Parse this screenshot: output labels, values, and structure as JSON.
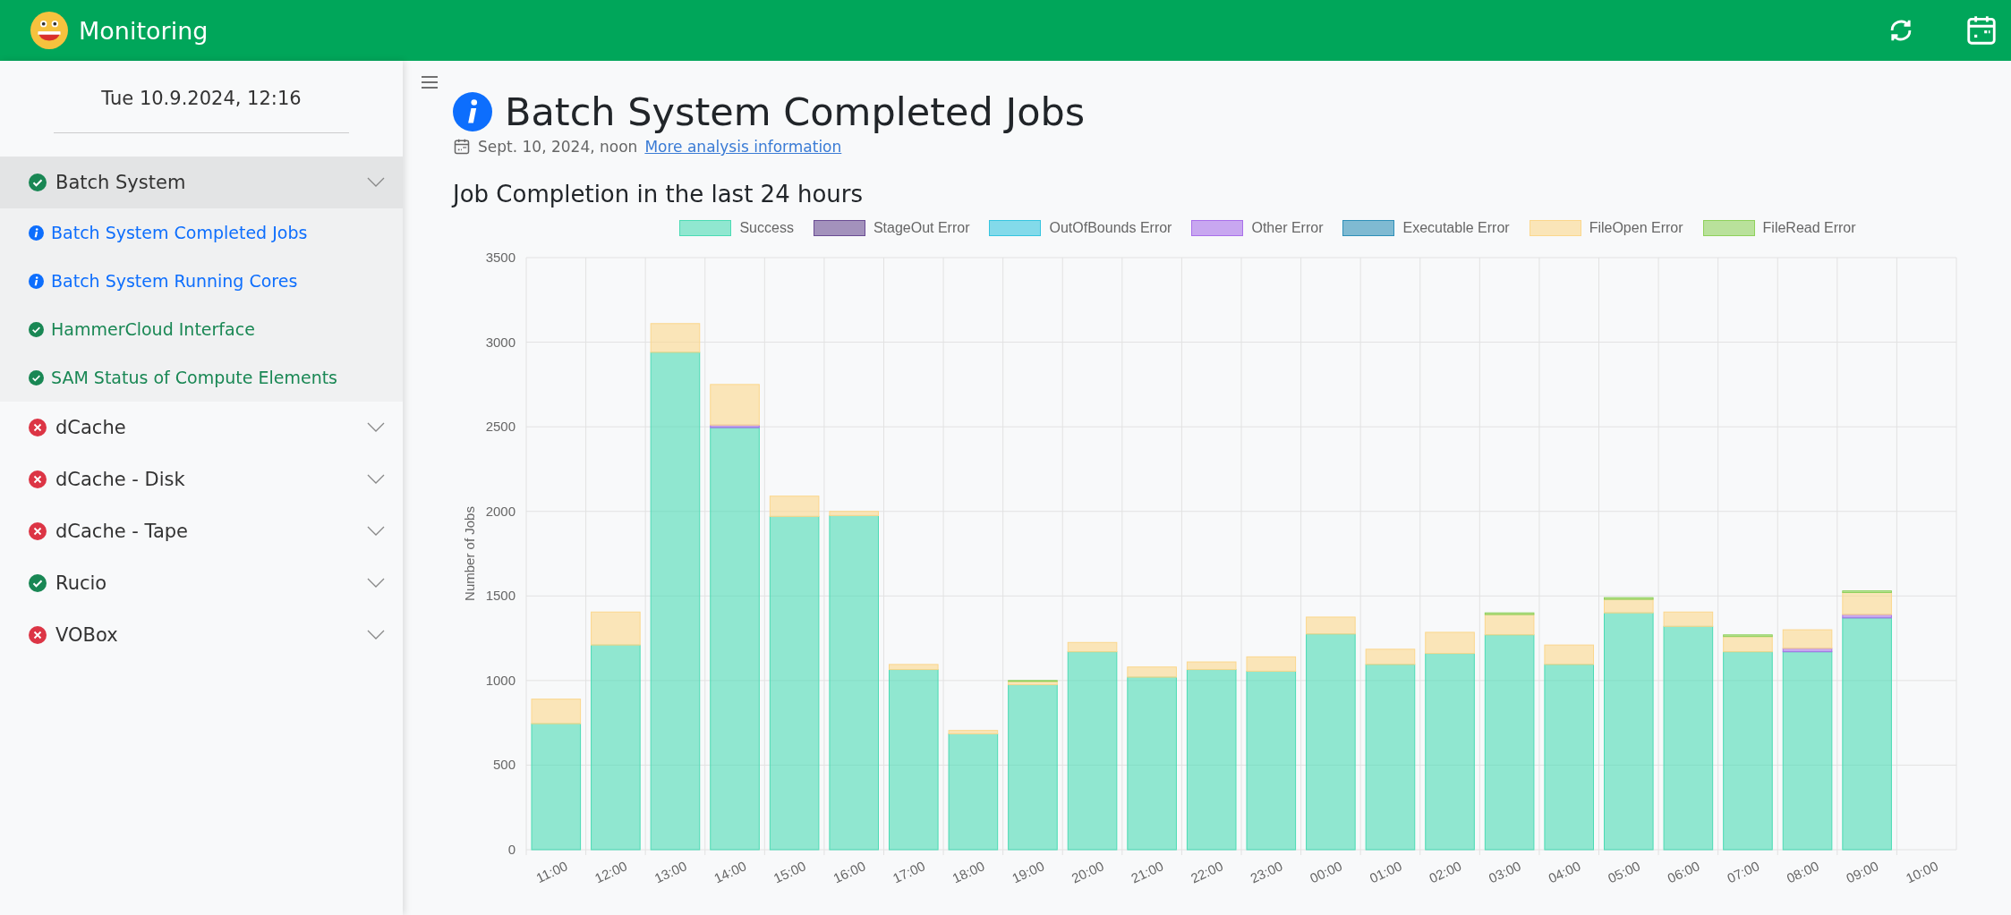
{
  "app": {
    "title": "Monitoring"
  },
  "sidebar": {
    "datetime": "Tue 10.9.2024, 12:16",
    "groups": [
      {
        "label": "Batch System",
        "kind": "ok",
        "expanded": true,
        "children": [
          {
            "label": "Batch System Completed Jobs",
            "kind": "info"
          },
          {
            "label": "Batch System Running Cores",
            "kind": "info"
          },
          {
            "label": "HammerCloud Interface",
            "kind": "ok"
          },
          {
            "label": "SAM Status of Compute Elements",
            "kind": "ok"
          }
        ]
      },
      {
        "label": "dCache",
        "kind": "error",
        "expanded": false
      },
      {
        "label": "dCache - Disk",
        "kind": "error",
        "expanded": false
      },
      {
        "label": "dCache - Tape",
        "kind": "error",
        "expanded": false
      },
      {
        "label": "Rucio",
        "kind": "ok",
        "expanded": false
      },
      {
        "label": "VOBox",
        "kind": "error",
        "expanded": false
      }
    ]
  },
  "page": {
    "title": "Batch System Completed Jobs",
    "kind": "info",
    "date": "Sept. 10, 2024, noon",
    "link": "More analysis information",
    "section_title": "Job Completion in the last 24 hours",
    "chart_data": {
      "type": "bar",
      "stacked": true,
      "grid": true,
      "legend": "top",
      "ylabel": "Number of Jobs",
      "ylim": [
        0,
        3500
      ],
      "yticks": [
        0,
        500,
        1000,
        1500,
        2000,
        2500,
        3000,
        3500
      ],
      "categories": [
        "11:00",
        "12:00",
        "13:00",
        "14:00",
        "15:00",
        "16:00",
        "17:00",
        "18:00",
        "19:00",
        "20:00",
        "21:00",
        "22:00",
        "23:00",
        "00:00",
        "01:00",
        "02:00",
        "03:00",
        "04:00",
        "05:00",
        "06:00",
        "07:00",
        "08:00",
        "09:00",
        "10:00"
      ],
      "series": [
        {
          "name": "Success",
          "color": "#4bdbb4",
          "values": [
            745,
            1210,
            2940,
            2495,
            1970,
            1975,
            1065,
            685,
            975,
            1170,
            1020,
            1065,
            1055,
            1275,
            1095,
            1160,
            1270,
            1095,
            1400,
            1320,
            1170,
            1170,
            1370,
            null
          ]
        },
        {
          "name": "StageOut Error",
          "color": "#6a4c93",
          "values": [
            0,
            0,
            0,
            0,
            0,
            0,
            0,
            0,
            0,
            0,
            0,
            0,
            0,
            0,
            0,
            0,
            0,
            0,
            0,
            0,
            0,
            0,
            0,
            null
          ]
        },
        {
          "name": "OutOfBounds Error",
          "color": "#36c5e0",
          "values": [
            0,
            0,
            0,
            0,
            0,
            0,
            0,
            0,
            0,
            0,
            0,
            0,
            0,
            0,
            0,
            0,
            0,
            0,
            0,
            0,
            0,
            0,
            0,
            null
          ]
        },
        {
          "name": "Other Error",
          "color": "#a970ea",
          "values": [
            0,
            0,
            0,
            15,
            0,
            0,
            0,
            0,
            0,
            0,
            0,
            0,
            0,
            0,
            0,
            0,
            0,
            0,
            0,
            0,
            0,
            20,
            20,
            null
          ]
        },
        {
          "name": "Executable Error",
          "color": "#2e8fb8",
          "values": [
            0,
            0,
            0,
            0,
            0,
            0,
            0,
            0,
            0,
            0,
            0,
            0,
            0,
            0,
            0,
            0,
            0,
            0,
            0,
            0,
            0,
            0,
            0,
            null
          ]
        },
        {
          "name": "FileOpen Error",
          "color": "#fbd78c",
          "values": [
            145,
            195,
            170,
            240,
            120,
            25,
            30,
            20,
            20,
            55,
            60,
            45,
            85,
            100,
            90,
            125,
            120,
            115,
            80,
            85,
            90,
            110,
            130,
            null
          ]
        },
        {
          "name": "FileRead Error",
          "color": "#8fd15b",
          "values": [
            0,
            0,
            0,
            0,
            0,
            0,
            0,
            0,
            5,
            0,
            0,
            0,
            0,
            0,
            0,
            0,
            10,
            0,
            10,
            0,
            10,
            0,
            10,
            null
          ]
        }
      ]
    }
  }
}
